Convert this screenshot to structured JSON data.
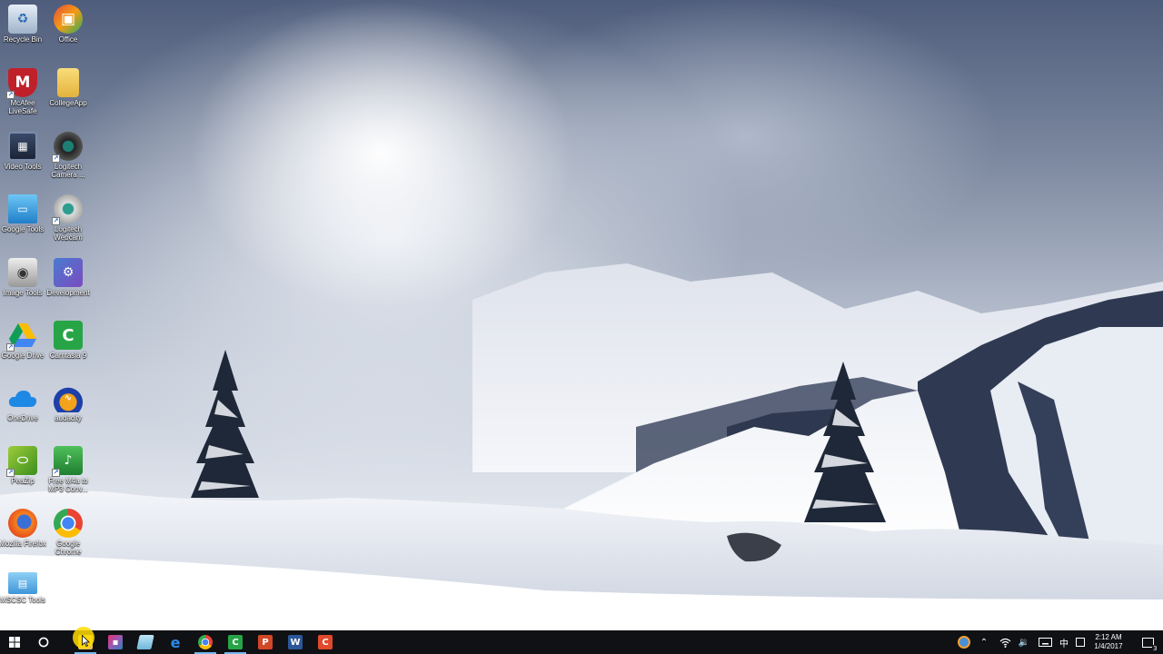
{
  "desktop": {
    "icons": [
      {
        "label": "Recycle Bin",
        "icon": "recycle-bin-icon"
      },
      {
        "label": "Office",
        "icon": "office-icon"
      },
      {
        "label": "McAfee LiveSafe",
        "icon": "mcafee-icon"
      },
      {
        "label": "CollegeApp",
        "icon": "folder-icon"
      },
      {
        "label": "Video Tools",
        "icon": "video-tools-icon"
      },
      {
        "label": "Logitech Camera ...",
        "icon": "webcam-icon"
      },
      {
        "label": "Google Tools",
        "icon": "google-tools-icon"
      },
      {
        "label": "Logitech Webcam",
        "icon": "webcam-icon"
      },
      {
        "label": "Image Tools",
        "icon": "image-tools-icon"
      },
      {
        "label": "Development",
        "icon": "development-icon"
      },
      {
        "label": "Google Drive",
        "icon": "google-drive-icon"
      },
      {
        "label": "Camtasia 9",
        "icon": "camtasia-icon"
      },
      {
        "label": "OneDrive",
        "icon": "onedrive-icon"
      },
      {
        "label": "audacity",
        "icon": "audacity-icon"
      },
      {
        "label": "PeaZip",
        "icon": "peazip-icon"
      },
      {
        "label": "Free M4a to MP3 Conv...",
        "icon": "converter-icon"
      },
      {
        "label": "Mozilla Firefox",
        "icon": "firefox-icon"
      },
      {
        "label": "Google Chrome",
        "icon": "chrome-icon"
      },
      {
        "label": "MSCSC Tools",
        "icon": "mscsc-tools-icon"
      }
    ]
  },
  "taskbar": {
    "start": "start-icon",
    "search": "cortana-icon",
    "pinned": [
      {
        "name": "file-explorer",
        "icon": "folder-icon"
      },
      {
        "name": "store",
        "icon": "store-icon"
      },
      {
        "name": "notepad",
        "icon": "notepad-icon"
      },
      {
        "name": "edge",
        "icon": "edge-icon"
      },
      {
        "name": "chrome",
        "icon": "chrome-icon"
      },
      {
        "name": "camtasia",
        "icon": "camtasia-icon"
      },
      {
        "name": "powerpoint",
        "icon": "powerpoint-icon"
      },
      {
        "name": "word",
        "icon": "word-icon"
      },
      {
        "name": "camtasia-recorder",
        "icon": "camtasia-recorder-icon"
      }
    ],
    "tray": {
      "clock_time": "2:12 AM",
      "clock_date": "1/4/2017",
      "ime": "中",
      "notification_count": "3"
    }
  },
  "colors": {
    "taskbar_bg": "#101114",
    "accent": "#76b9ed",
    "cursor_highlight": "#ffdc00"
  }
}
